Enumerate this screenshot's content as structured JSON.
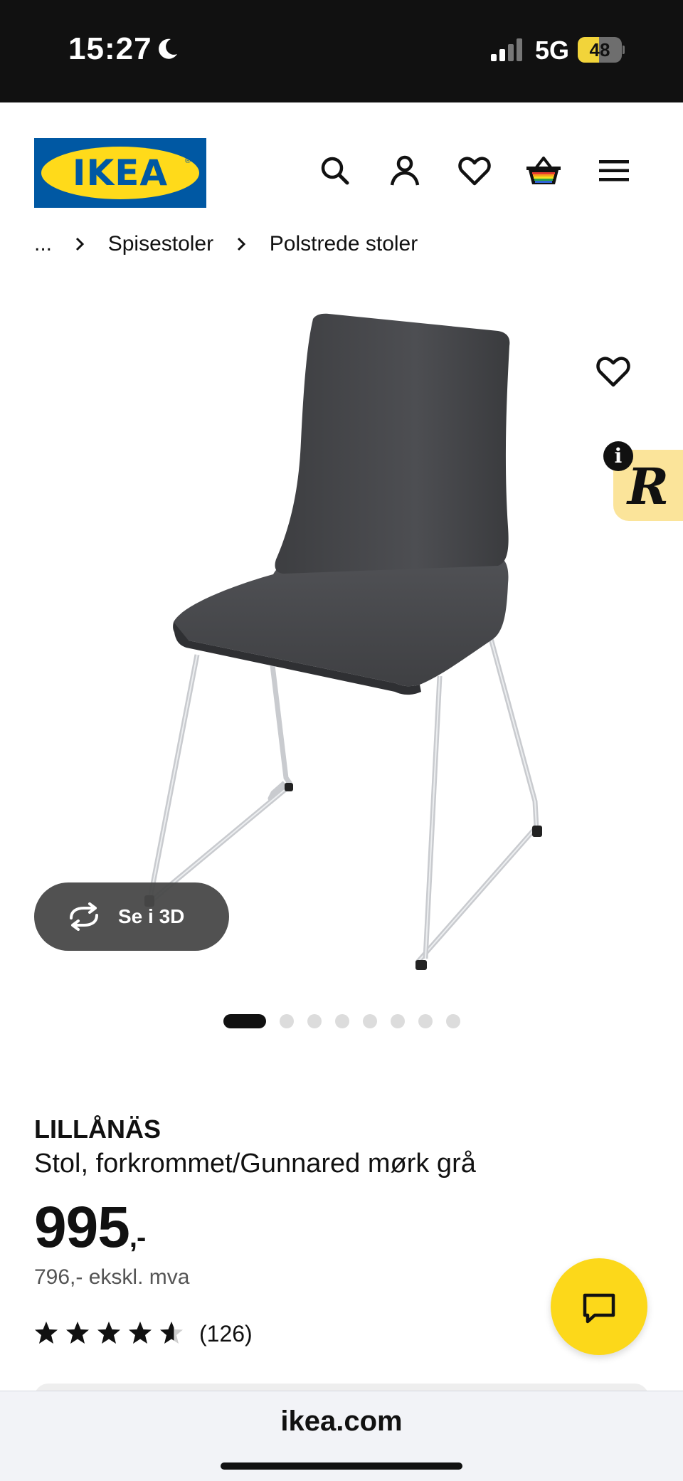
{
  "status_bar": {
    "time": "15:27",
    "network": "5G",
    "battery_level": 48,
    "battery_label": "48",
    "icons": [
      "moon-icon",
      "signal-icon",
      "battery-icon"
    ]
  },
  "header": {
    "logo_text": "IKEA",
    "logo_registered": "®",
    "icons": [
      "search-icon",
      "account-icon",
      "favorites-icon",
      "cart-icon",
      "menu-icon"
    ]
  },
  "breadcrumb": {
    "items": [
      "...",
      "Spisestoler",
      "Polstrede stoler"
    ]
  },
  "gallery": {
    "view_3d_label": "Se i 3D",
    "dot_count": 8,
    "active_index": 0,
    "extension_badge_letter": "R",
    "extension_info_letter": "i"
  },
  "product": {
    "name": "LILLÅNÄS",
    "description": "Stol, forkrommet/Gunnared mørk grå",
    "price": "995",
    "price_suffix": ",-",
    "price_ex_vat": "796,- ekskl. mva",
    "rating_value": 4.6,
    "rating_max": 5,
    "review_count": "(126)"
  },
  "browser": {
    "url": "ikea.com"
  },
  "colors": {
    "ikea_blue": "#0058a3",
    "ikea_yellow": "#ffda1a",
    "chat_yellow": "#fcd81a",
    "upholstery": "#4a4b4e",
    "chrome": "#c9cbcf"
  }
}
